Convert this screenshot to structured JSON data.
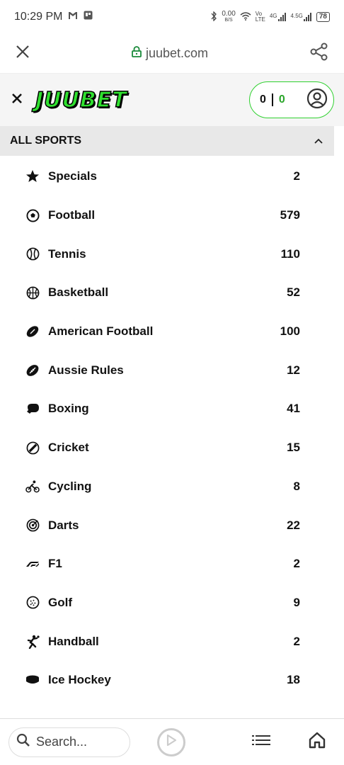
{
  "status_bar": {
    "time": "10:29 PM",
    "net_speed": "0.00",
    "net_unit": "B/S",
    "signal1": "4G",
    "signal2": "4.5G",
    "battery": "78"
  },
  "browser": {
    "url": "juubet.com"
  },
  "header": {
    "logo": "JUUBET",
    "balance_left": "0",
    "balance_right": "0"
  },
  "section": {
    "title": "ALL SPORTS"
  },
  "sports": [
    {
      "label": "Specials",
      "count": "2",
      "icon": "star-icon"
    },
    {
      "label": "Football",
      "count": "579",
      "icon": "soccer-ball-icon"
    },
    {
      "label": "Tennis",
      "count": "110",
      "icon": "tennis-ball-icon"
    },
    {
      "label": "Basketball",
      "count": "52",
      "icon": "basketball-icon"
    },
    {
      "label": "American Football",
      "count": "100",
      "icon": "american-football-icon"
    },
    {
      "label": "Aussie Rules",
      "count": "12",
      "icon": "aussie-rules-icon"
    },
    {
      "label": "Boxing",
      "count": "41",
      "icon": "boxing-glove-icon"
    },
    {
      "label": "Cricket",
      "count": "15",
      "icon": "cricket-icon"
    },
    {
      "label": "Cycling",
      "count": "8",
      "icon": "cycling-icon"
    },
    {
      "label": "Darts",
      "count": "22",
      "icon": "darts-target-icon"
    },
    {
      "label": "F1",
      "count": "2",
      "icon": "f1-icon"
    },
    {
      "label": "Golf",
      "count": "9",
      "icon": "golf-ball-icon"
    },
    {
      "label": "Handball",
      "count": "2",
      "icon": "handball-icon"
    },
    {
      "label": "Ice Hockey",
      "count": "18",
      "icon": "ice-hockey-puck-icon"
    }
  ],
  "bottom_bar": {
    "search_placeholder": "Search..."
  },
  "colors": {
    "brand_green": "#2fe02f",
    "balance_green": "#2aa52a"
  }
}
